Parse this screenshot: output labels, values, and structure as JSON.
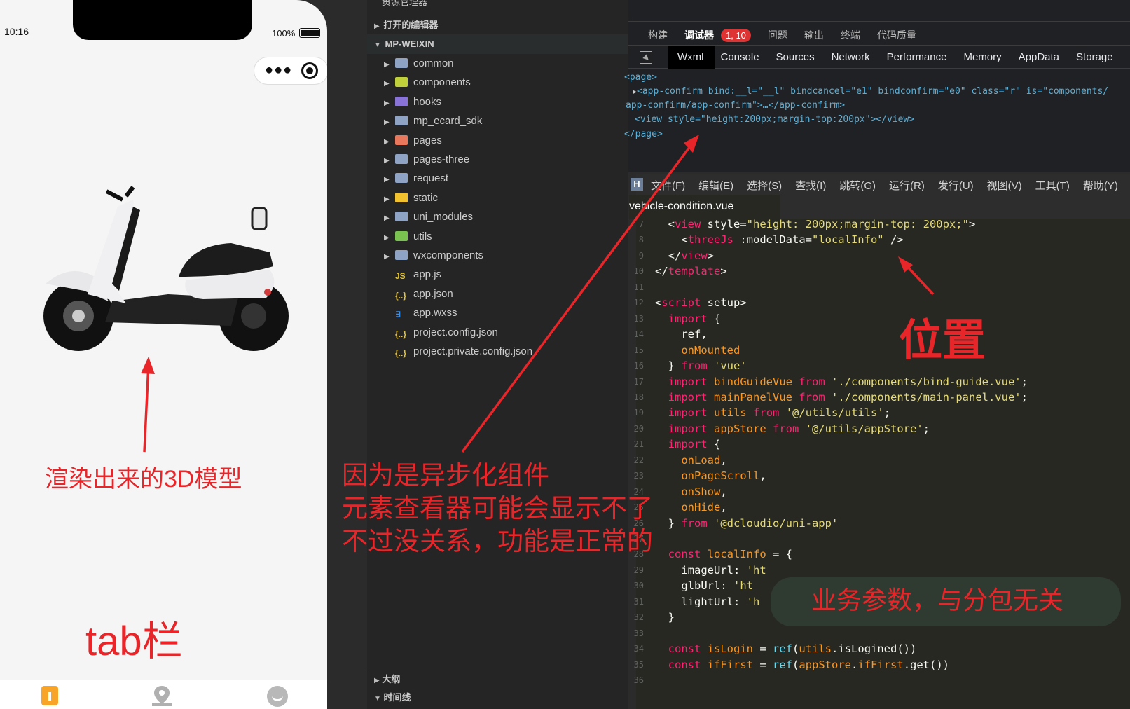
{
  "phone": {
    "time": "10:16",
    "battery": "100%"
  },
  "annotations": {
    "model": "渲染出来的3D模型",
    "tabbar": "tab栏",
    "async_line1": "因为是异步化组件",
    "async_line2": "元素查看器可能会显示不了",
    "async_line3": "不过没关系，功能是正常的",
    "position": "位置",
    "biz": "业务参数，与分包无关"
  },
  "explorer": {
    "top_title": "资源管理器",
    "open_editors": "打开的编辑器",
    "project": "MP-WEIXIN",
    "items": [
      {
        "label": "common",
        "icon": "folder-icon",
        "color": "#8fa3c4",
        "chev": true
      },
      {
        "label": "components",
        "icon": "folder-icon",
        "color": "#c0d03a",
        "chev": true
      },
      {
        "label": "hooks",
        "icon": "folder-icon",
        "color": "#8a73d6",
        "chev": true
      },
      {
        "label": "mp_ecard_sdk",
        "icon": "folder-icon",
        "color": "#8fa3c4",
        "chev": true
      },
      {
        "label": "pages",
        "icon": "folder-icon",
        "color": "#e9775b",
        "chev": true
      },
      {
        "label": "pages-three",
        "icon": "folder-icon",
        "color": "#8fa3c4",
        "chev": true
      },
      {
        "label": "request",
        "icon": "folder-icon",
        "color": "#8fa3c4",
        "chev": true
      },
      {
        "label": "static",
        "icon": "folder-icon",
        "color": "#f2c12e",
        "chev": true
      },
      {
        "label": "uni_modules",
        "icon": "folder-icon",
        "color": "#8fa3c4",
        "chev": true
      },
      {
        "label": "utils",
        "icon": "folder-icon",
        "color": "#7ac24f",
        "chev": true
      },
      {
        "label": "wxcomponents",
        "icon": "folder-icon",
        "color": "#8fa3c4",
        "chev": true
      },
      {
        "label": "app.js",
        "icon": "js-file-icon",
        "color": "#e8c52b",
        "chev": false
      },
      {
        "label": "app.json",
        "icon": "json-file-icon",
        "color": "#e8c52b",
        "chev": false
      },
      {
        "label": "app.wxss",
        "icon": "css-file-icon",
        "color": "#3a8ee6",
        "chev": false
      },
      {
        "label": "project.config.json",
        "icon": "json-file-icon",
        "color": "#e8c52b",
        "chev": false
      },
      {
        "label": "project.private.config.json",
        "icon": "json-file-icon",
        "color": "#e8c52b",
        "chev": false
      }
    ],
    "outline": "大纲",
    "timeline": "时间线"
  },
  "debugger": {
    "top_tabs": [
      "构建",
      "调试器",
      "问题",
      "输出",
      "终端",
      "代码质量"
    ],
    "badge": "1, 10",
    "panel_tabs": [
      "Wxml",
      "Console",
      "Sources",
      "Network",
      "Performance",
      "Memory",
      "AppData",
      "Storage"
    ],
    "wxml": [
      "<page>",
      "<app-confirm bind:__l=\"__l\" bindcancel=\"e1\" bindconfirm=\"e0\" class=\"r\" is=\"components/",
      "app-confirm/app-confirm\">…</app-confirm>",
      "<view style=\"height:200px;margin-top:200px\"></view>",
      "</page>"
    ]
  },
  "editor": {
    "menu": [
      "文件(F)",
      "编辑(E)",
      "选择(S)",
      "查找(I)",
      "跳转(G)",
      "运行(R)",
      "发行(U)",
      "视图(V)",
      "工具(T)",
      "帮助(Y)"
    ],
    "tab": "vehicle-condition.vue",
    "lines": [
      {
        "n": "7",
        "t": "  <view style=\"height: 200px;margin-top: 200px;\">"
      },
      {
        "n": "8",
        "t": "    <threeJs :modelData=\"localInfo\" />"
      },
      {
        "n": "9",
        "t": "  </view>"
      },
      {
        "n": "10",
        "t": "</template>"
      },
      {
        "n": "11",
        "t": ""
      },
      {
        "n": "12",
        "t": "<script setup>"
      },
      {
        "n": "13",
        "t": "  import {"
      },
      {
        "n": "14",
        "t": "    ref,"
      },
      {
        "n": "15",
        "t": "    onMounted"
      },
      {
        "n": "16",
        "t": "  } from 'vue'"
      },
      {
        "n": "17",
        "t": "  import bindGuideVue from './components/bind-guide.vue';"
      },
      {
        "n": "18",
        "t": "  import mainPanelVue from './components/main-panel.vue';"
      },
      {
        "n": "19",
        "t": "  import utils from '@/utils/utils';"
      },
      {
        "n": "20",
        "t": "  import appStore from '@/utils/appStore';"
      },
      {
        "n": "21",
        "t": "  import {"
      },
      {
        "n": "22",
        "t": "    onLoad,"
      },
      {
        "n": "23",
        "t": "    onPageScroll,"
      },
      {
        "n": "24",
        "t": "    onShow,"
      },
      {
        "n": "25",
        "t": "    onHide,"
      },
      {
        "n": "26",
        "t": "  } from '@dcloudio/uni-app'"
      },
      {
        "n": "27",
        "t": ""
      },
      {
        "n": "28",
        "t": "  const localInfo = {"
      },
      {
        "n": "29",
        "t": "    imageUrl: 'ht"
      },
      {
        "n": "30",
        "t": "    glbUrl: 'ht"
      },
      {
        "n": "31",
        "t": "    lightUrl: 'h"
      },
      {
        "n": "32",
        "t": "  }"
      },
      {
        "n": "33",
        "t": ""
      },
      {
        "n": "34",
        "t": "  const isLogin = ref(utils.isLogined())"
      },
      {
        "n": "35",
        "t": "  const ifFirst = ref(appStore.ifFirst.get())"
      },
      {
        "n": "36",
        "t": ""
      }
    ]
  }
}
